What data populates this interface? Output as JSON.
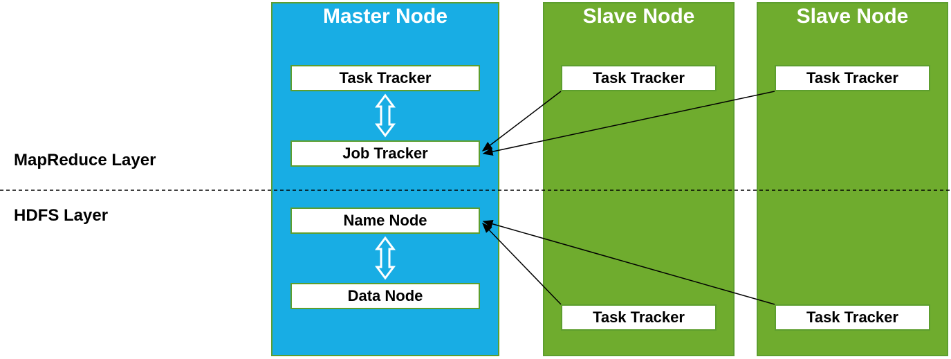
{
  "labels": {
    "mapreduce": "MapReduce Layer",
    "hdfs": "HDFS Layer"
  },
  "nodes": {
    "master": {
      "title": "Master Node",
      "task_tracker": "Task Tracker",
      "job_tracker": "Job Tracker",
      "name_node": "Name Node",
      "data_node": "Data Node"
    },
    "slave1": {
      "title": "Slave Node",
      "task_tracker_top": "Task Tracker",
      "task_tracker_bottom": "Task Tracker"
    },
    "slave2": {
      "title": "Slave Node",
      "task_tracker_top": "Task Tracker",
      "task_tracker_bottom": "Task Tracker"
    }
  }
}
